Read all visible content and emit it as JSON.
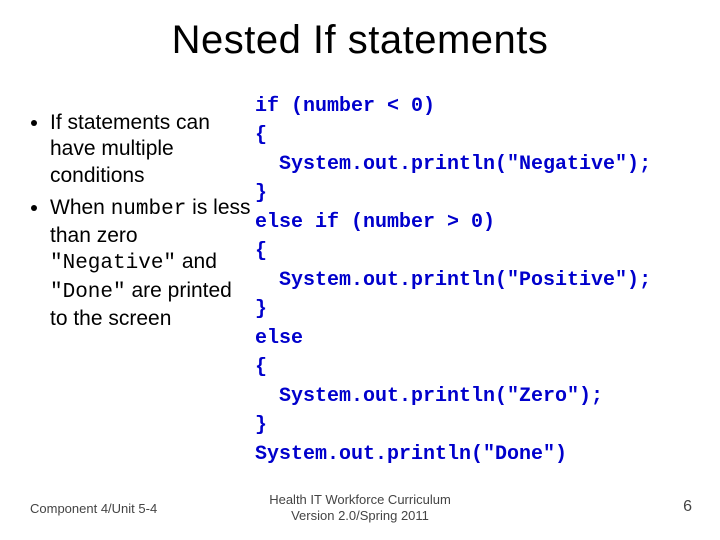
{
  "title": "Nested If statements",
  "bullets": {
    "b1_pre": "If statements can have multiple conditions",
    "b2_pre": "When ",
    "b2_code1": "number",
    "b2_mid1": " is less than zero ",
    "b2_code2": "\"Negative\"",
    "b2_mid2": " and ",
    "b2_code3": "\"Done\"",
    "b2_post": " are printed to the screen"
  },
  "code": "if (number < 0)\n{\n  System.out.println(\"Negative\");\n}\nelse if (number > 0)\n{\n  System.out.println(\"Positive\");\n}\nelse\n{\n  System.out.println(\"Zero\");\n}\nSystem.out.println(\"Done\")",
  "footer": {
    "left": "Component 4/Unit 5-4",
    "center_line1": "Health IT Workforce Curriculum",
    "center_line2": "Version 2.0/Spring 2011",
    "right": "6"
  }
}
